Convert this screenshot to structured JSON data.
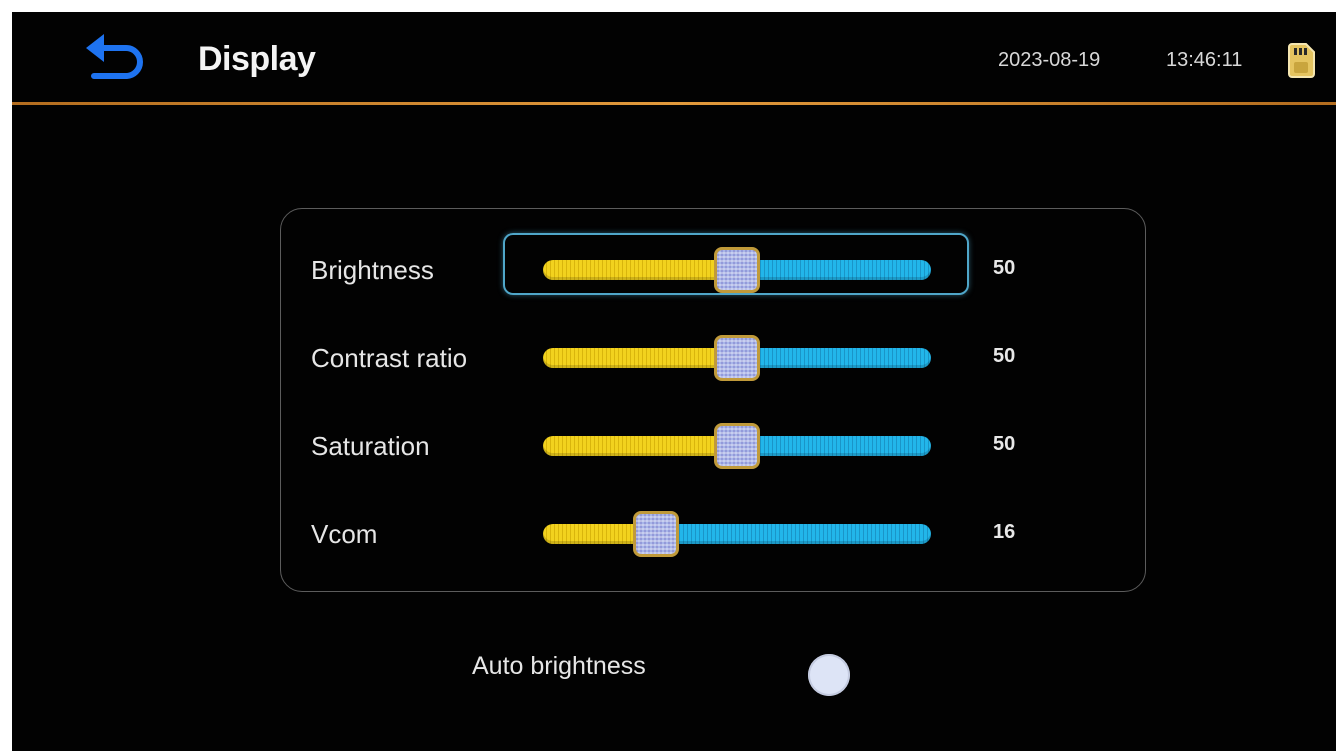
{
  "header": {
    "title": "Display",
    "date": "2023-08-19",
    "time": "13:46:11",
    "back_icon": "back-arrow-icon",
    "storage_icon": "sd-card-icon"
  },
  "colors": {
    "background": "#020202",
    "divider": "#e29a3c",
    "slider_fill": "#f2d21e",
    "slider_rest": "#22b6ea",
    "focus": "#4fa6c9"
  },
  "sliders": [
    {
      "label": "Brightness",
      "value": "50",
      "level": 0.5,
      "focused": true
    },
    {
      "label": "Contrast ratio",
      "value": "50",
      "level": 0.5,
      "focused": false
    },
    {
      "label": "Saturation",
      "value": "50",
      "level": 0.5,
      "focused": false
    },
    {
      "label": "Vcom",
      "value": "16",
      "level": 0.29,
      "focused": false
    }
  ],
  "auto_brightness": {
    "label": "Auto brightness",
    "enabled": false
  }
}
